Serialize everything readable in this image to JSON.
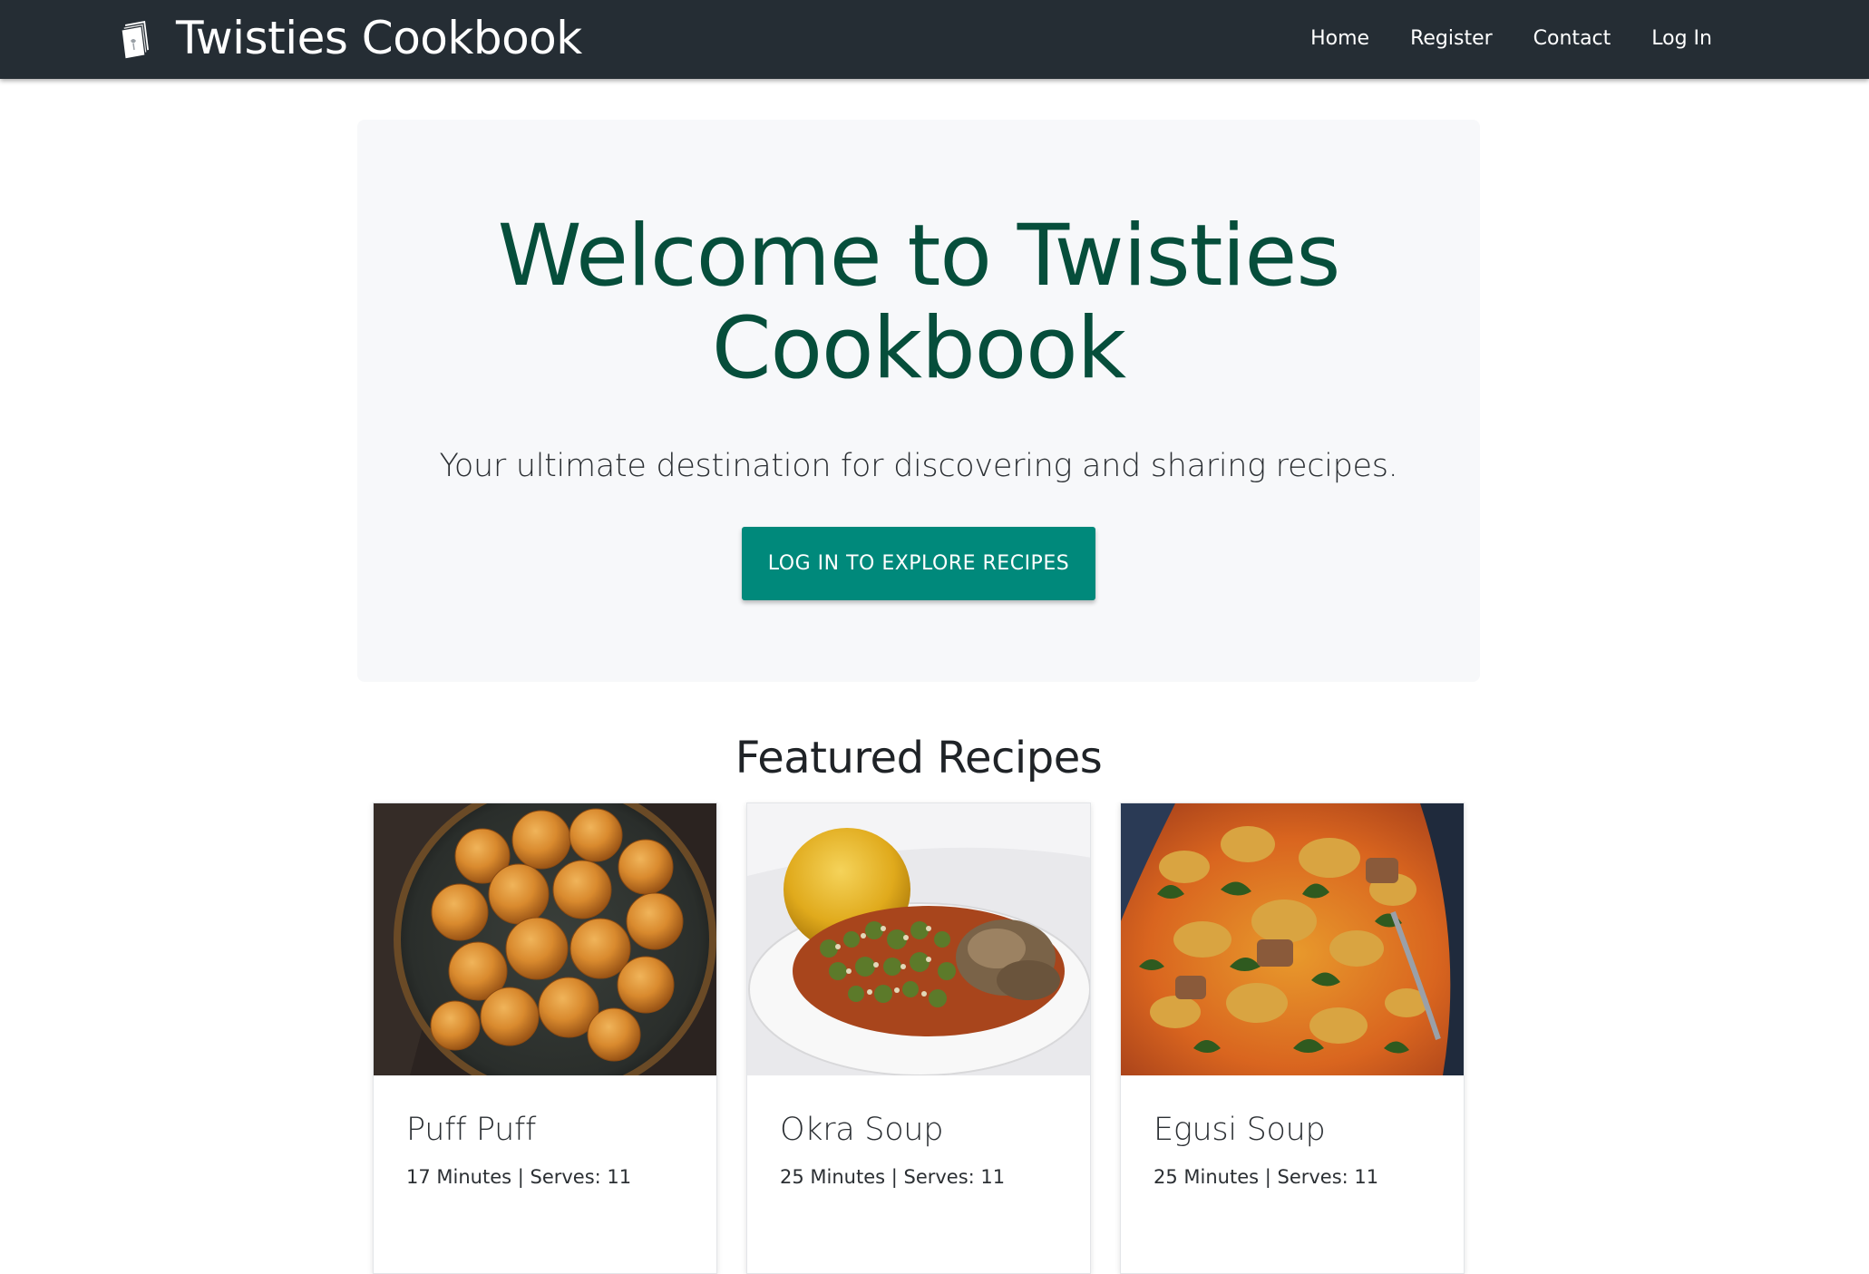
{
  "navbar": {
    "brand": "Twisties Cookbook",
    "links": [
      {
        "label": "Home"
      },
      {
        "label": "Register"
      },
      {
        "label": "Contact"
      },
      {
        "label": "Log In"
      }
    ]
  },
  "hero": {
    "title_line1": "Welcome to Twisties",
    "title_line2": "Cookbook",
    "subtitle": "Your ultimate destination for discovering and sharing recipes.",
    "button_label": "LOG IN TO EXPLORE RECIPES"
  },
  "featured": {
    "heading": "Featured Recipes",
    "recipes": [
      {
        "title": "Puff Puff",
        "meta": "17 Minutes | Serves: 11"
      },
      {
        "title": "Okra Soup",
        "meta": "25 Minutes | Serves: 11"
      },
      {
        "title": "Egusi Soup",
        "meta": "25 Minutes | Serves: 11"
      }
    ]
  },
  "colors": {
    "navbar_bg": "#252d34",
    "hero_bg": "#f7f8fa",
    "title_green": "#064e3b",
    "button_teal": "#00897b"
  },
  "icons": {
    "brand": "cookbook-icon"
  }
}
